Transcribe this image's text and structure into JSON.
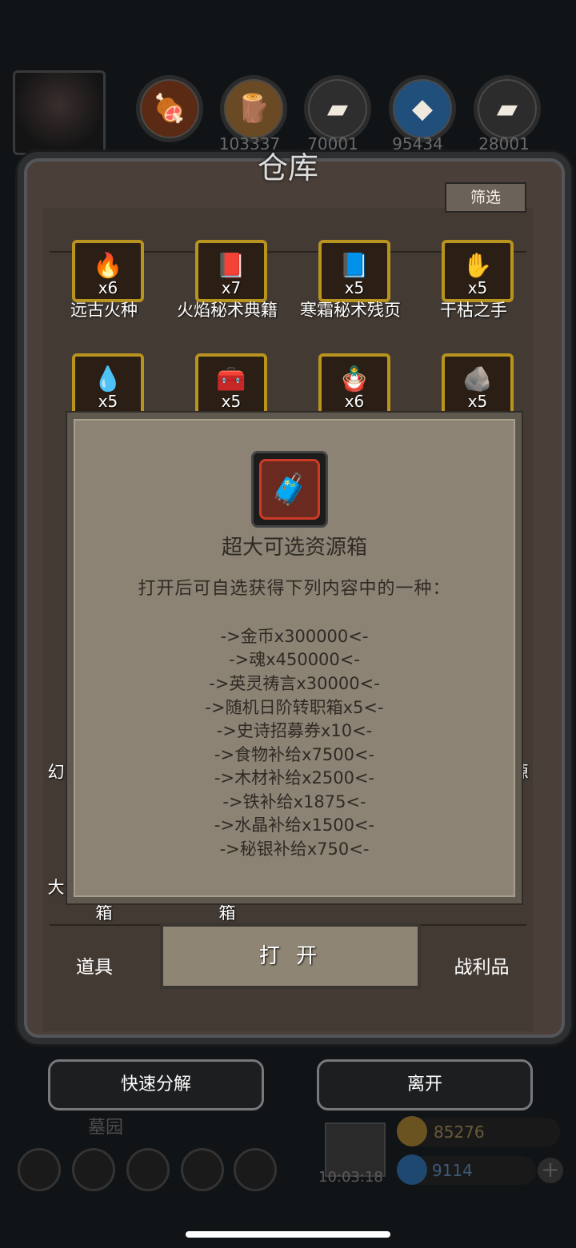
{
  "header": {
    "resources": [
      {
        "icon": "meat-icon",
        "value": ""
      },
      {
        "icon": "wood-icon",
        "value": "103337"
      },
      {
        "icon": "iron-icon",
        "value": "70001"
      },
      {
        "icon": "crystal-icon",
        "value": "95434"
      },
      {
        "icon": "mithril-icon",
        "value": "28001"
      }
    ]
  },
  "warehouse": {
    "title": "仓库",
    "filter_label": "筛选",
    "items_row1": [
      {
        "name": "远古火种",
        "qty": "x6",
        "icon": "flame-icon"
      },
      {
        "name": "火焰秘术典籍",
        "qty": "x7",
        "icon": "book-icon"
      },
      {
        "name": "寒霜秘术残页",
        "qty": "x5",
        "icon": "book-icon"
      },
      {
        "name": "干枯之手",
        "qty": "x5",
        "icon": "hand-icon"
      }
    ],
    "items_row2": [
      {
        "qty": "x5",
        "icon": "pink-crystal-icon"
      },
      {
        "qty": "x5",
        "icon": "chest-icon"
      },
      {
        "qty": "x6",
        "icon": "doll-icon"
      },
      {
        "qty": "x5",
        "icon": "ore-icon"
      }
    ],
    "partial_labels": {
      "left_mid": "幻",
      "right_mid": "源",
      "bottom_left": "大",
      "box1": "箱",
      "box2": "箱"
    }
  },
  "popup": {
    "title": "超大可选资源箱",
    "description": "打开后可自选获得下列内容中的一种：",
    "options": [
      "->金币x300000<-",
      "->魂x450000<-",
      "->英灵祷言x30000<-",
      "->随机日阶转职箱x5<-",
      "->史诗招募券x10<-",
      "->食物补给x7500<-",
      "->木材补给x2500<-",
      "->铁补给x1875<-",
      "->水晶补给x1500<-",
      "->秘银补给x750<-"
    ]
  },
  "actions": {
    "open_label": "打 开",
    "tab_items": "道具",
    "tab_loot": "战利品",
    "quick_decompose": "快速分解",
    "leave": "离开"
  },
  "footer": {
    "location": "墓园",
    "time": "10:03:18",
    "gold": "85276",
    "gems": "9114"
  }
}
